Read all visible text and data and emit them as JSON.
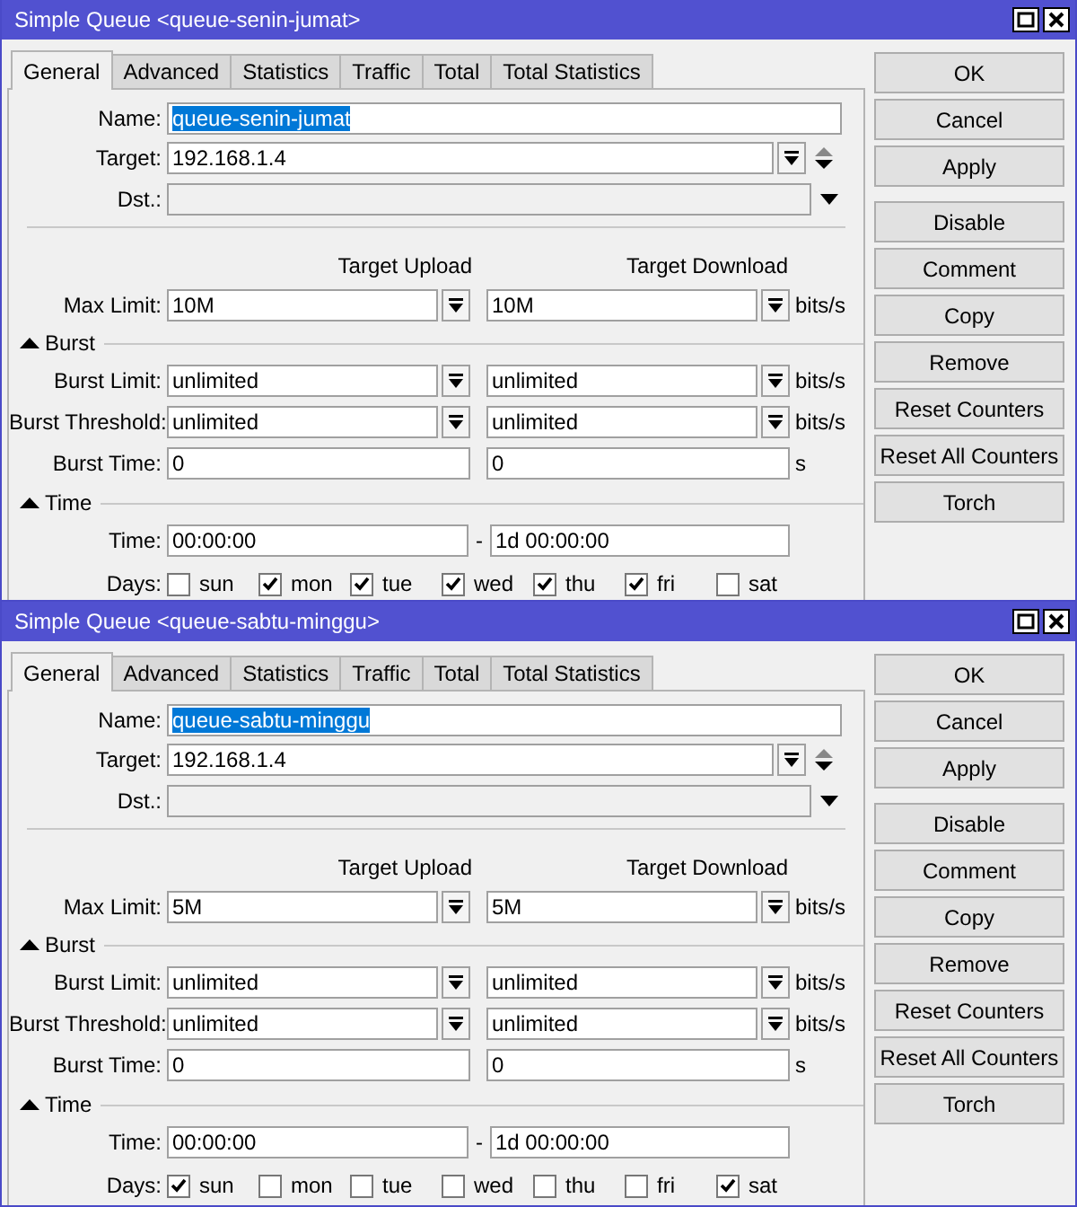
{
  "windows": [
    {
      "title": "Simple Queue <queue-senin-jumat>",
      "tabs": [
        {
          "label": "General",
          "selected": true
        },
        {
          "label": "Advanced",
          "selected": false
        },
        {
          "label": "Statistics",
          "selected": false
        },
        {
          "label": "Traffic",
          "selected": false
        },
        {
          "label": "Total",
          "selected": false
        },
        {
          "label": "Total Statistics",
          "selected": false
        }
      ],
      "name": {
        "label": "Name:",
        "value": "queue-senin-jumat",
        "text_selected": true
      },
      "target": {
        "label": "Target:",
        "value": "192.168.1.4"
      },
      "dst": {
        "label": "Dst.:"
      },
      "column_headers": [
        "Target Upload",
        "Target Download"
      ],
      "max_limit": {
        "kind": "dropdown",
        "label": "Max Limit:",
        "upload": "10M",
        "download": "10M",
        "unit": "bits/s"
      },
      "burst": {
        "title": "Burst",
        "expanded": true,
        "rows": [
          {
            "kind": "dropdown",
            "label": "Burst Limit:",
            "upload": "unlimited",
            "download": "unlimited",
            "unit": "bits/s"
          },
          {
            "kind": "dropdown",
            "label": "Burst Threshold:",
            "upload": "unlimited",
            "download": "unlimited",
            "unit": "bits/s"
          },
          {
            "kind": "plain",
            "label": "Burst Time:",
            "upload": "0",
            "download": "0",
            "unit": "s"
          }
        ]
      },
      "time": {
        "title": "Time",
        "expanded": true,
        "label": "Time:",
        "from": "00:00:00",
        "separator": "-",
        "to": "1d 00:00:00",
        "days_label": "Days:",
        "days": [
          {
            "label": "sun",
            "checked": false
          },
          {
            "label": "mon",
            "checked": true
          },
          {
            "label": "tue",
            "checked": true
          },
          {
            "label": "wed",
            "checked": true
          },
          {
            "label": "thu",
            "checked": true
          },
          {
            "label": "fri",
            "checked": true
          },
          {
            "label": "sat",
            "checked": false
          }
        ]
      },
      "buttons": [
        "OK",
        "Cancel",
        "Apply",
        "Disable",
        "Comment",
        "Copy",
        "Remove",
        "Reset Counters",
        "Reset All Counters",
        "Torch"
      ]
    },
    {
      "title": "Simple Queue <queue-sabtu-minggu>",
      "tabs": [
        {
          "label": "General",
          "selected": true
        },
        {
          "label": "Advanced",
          "selected": false
        },
        {
          "label": "Statistics",
          "selected": false
        },
        {
          "label": "Traffic",
          "selected": false
        },
        {
          "label": "Total",
          "selected": false
        },
        {
          "label": "Total Statistics",
          "selected": false
        }
      ],
      "name": {
        "label": "Name:",
        "value": "queue-sabtu-minggu",
        "text_selected": true
      },
      "target": {
        "label": "Target:",
        "value": "192.168.1.4"
      },
      "dst": {
        "label": "Dst.:"
      },
      "column_headers": [
        "Target Upload",
        "Target Download"
      ],
      "max_limit": {
        "kind": "dropdown",
        "label": "Max Limit:",
        "upload": "5M",
        "download": "5M",
        "unit": "bits/s"
      },
      "burst": {
        "title": "Burst",
        "expanded": true,
        "rows": [
          {
            "kind": "dropdown",
            "label": "Burst Limit:",
            "upload": "unlimited",
            "download": "unlimited",
            "unit": "bits/s"
          },
          {
            "kind": "dropdown",
            "label": "Burst Threshold:",
            "upload": "unlimited",
            "download": "unlimited",
            "unit": "bits/s"
          },
          {
            "kind": "plain",
            "label": "Burst Time:",
            "upload": "0",
            "download": "0",
            "unit": "s"
          }
        ]
      },
      "time": {
        "title": "Time",
        "expanded": true,
        "label": "Time:",
        "from": "00:00:00",
        "separator": "-",
        "to": "1d 00:00:00",
        "days_label": "Days:",
        "days": [
          {
            "label": "sun",
            "checked": true
          },
          {
            "label": "mon",
            "checked": false
          },
          {
            "label": "tue",
            "checked": false
          },
          {
            "label": "wed",
            "checked": false
          },
          {
            "label": "thu",
            "checked": false
          },
          {
            "label": "fri",
            "checked": false
          },
          {
            "label": "sat",
            "checked": true
          }
        ]
      },
      "buttons": [
        "OK",
        "Cancel",
        "Apply",
        "Disable",
        "Comment",
        "Copy",
        "Remove",
        "Reset Counters",
        "Reset All Counters",
        "Torch"
      ]
    }
  ]
}
